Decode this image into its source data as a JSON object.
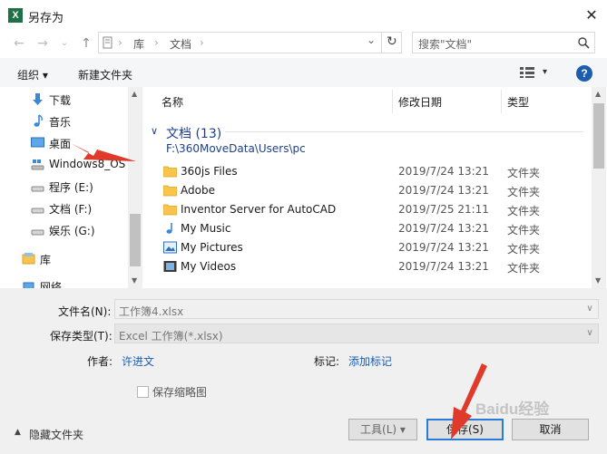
{
  "window": {
    "title": "另存为",
    "app_icon": "X",
    "close": "✕"
  },
  "address": {
    "path": [
      "库",
      "文档"
    ],
    "sep": "›",
    "chevron": "⌄",
    "refresh": "↻"
  },
  "search": {
    "placeholder": "搜索\"文档\""
  },
  "toolbar": {
    "organize": "组织 ▾",
    "new_folder": "新建文件夹",
    "help": "?"
  },
  "nav": {
    "items": [
      {
        "label": "下载",
        "icon": "download-icon"
      },
      {
        "label": "音乐",
        "icon": "music-icon"
      },
      {
        "label": "桌面",
        "icon": "desktop-icon"
      },
      {
        "label": "Windows8_OS",
        "icon": "drive-icon"
      },
      {
        "label": "程序 (E:)",
        "icon": "drive-icon"
      },
      {
        "label": "文档 (F:)",
        "icon": "drive-icon"
      },
      {
        "label": "娱乐 (G:)",
        "icon": "drive-icon"
      },
      {
        "label": "库",
        "icon": "library-icon"
      },
      {
        "label": "网络",
        "icon": "network-icon"
      }
    ]
  },
  "list": {
    "columns": [
      "名称",
      "修改日期",
      "类型"
    ],
    "group": {
      "title": "文档 (13)",
      "path": "F:\\360MoveData\\Users\\pc"
    },
    "rows": [
      {
        "name": "360js Files",
        "date": "2019/7/24 13:21",
        "type": "文件夹",
        "icon": "folder-icon"
      },
      {
        "name": "Adobe",
        "date": "2019/7/24 13:21",
        "type": "文件夹",
        "icon": "folder-icon"
      },
      {
        "name": "Inventor Server for AutoCAD",
        "date": "2019/7/25 21:11",
        "type": "文件夹",
        "icon": "folder-icon"
      },
      {
        "name": "My Music",
        "date": "2019/7/24 13:21",
        "type": "文件夹",
        "icon": "music-folder-icon"
      },
      {
        "name": "My Pictures",
        "date": "2019/7/24 13:21",
        "type": "文件夹",
        "icon": "pictures-folder-icon"
      },
      {
        "name": "My Videos",
        "date": "2019/7/24 13:21",
        "type": "文件夹",
        "icon": "videos-folder-icon"
      }
    ]
  },
  "form": {
    "filename_label": "文件名(N):",
    "filename_value": "工作簿4.xlsx",
    "filetype_label": "保存类型(T):",
    "filetype_value": "Excel 工作簿(*.xlsx)",
    "author_label": "作者:",
    "author_value": "许进文",
    "tags_label": "标记:",
    "tags_value": "添加标记",
    "thumbnail_label": "保存缩略图"
  },
  "footer": {
    "hide_folders": "隐藏文件夹",
    "tools": "工具(L)",
    "save": "保存(S)",
    "cancel": "取消"
  },
  "watermark": "Baidu经验",
  "colors": {
    "accent": "#1c5db0",
    "folder": "#f8c54a",
    "annotation": "#e03a2b"
  }
}
